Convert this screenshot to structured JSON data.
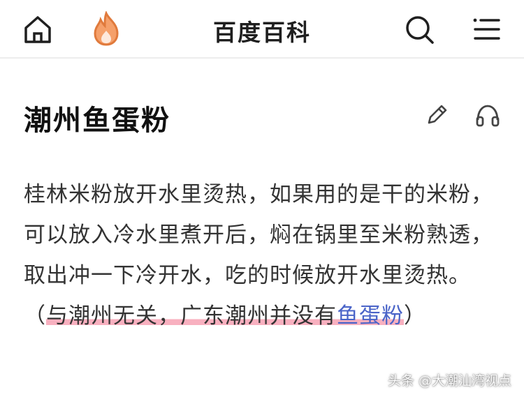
{
  "header": {
    "app_title": "百度百科",
    "icons": {
      "home": "home-icon",
      "hot": "flame-icon",
      "search": "search-icon",
      "menu": "menu-icon"
    }
  },
  "article": {
    "title": "潮州鱼蛋粉",
    "actions": {
      "edit": "edit-icon",
      "listen": "headphones-icon"
    },
    "body_plain": "桂林米粉放开水里烫热，如果用的是干的米粉，可以放入冷水里煮开后，焖在锅里至米粉熟透，取出冲一下冷开水，吃的时候放开水里烫热。",
    "note_open": " （",
    "note_highlight": "与潮州无关，广东潮州并没有",
    "note_link": "鱼蛋粉",
    "note_close": "）"
  },
  "watermark": "头条 @大潮汕湾视点",
  "colors": {
    "highlight": "#f696aa",
    "link": "#4a64c8",
    "flame": "#f08a4b"
  }
}
